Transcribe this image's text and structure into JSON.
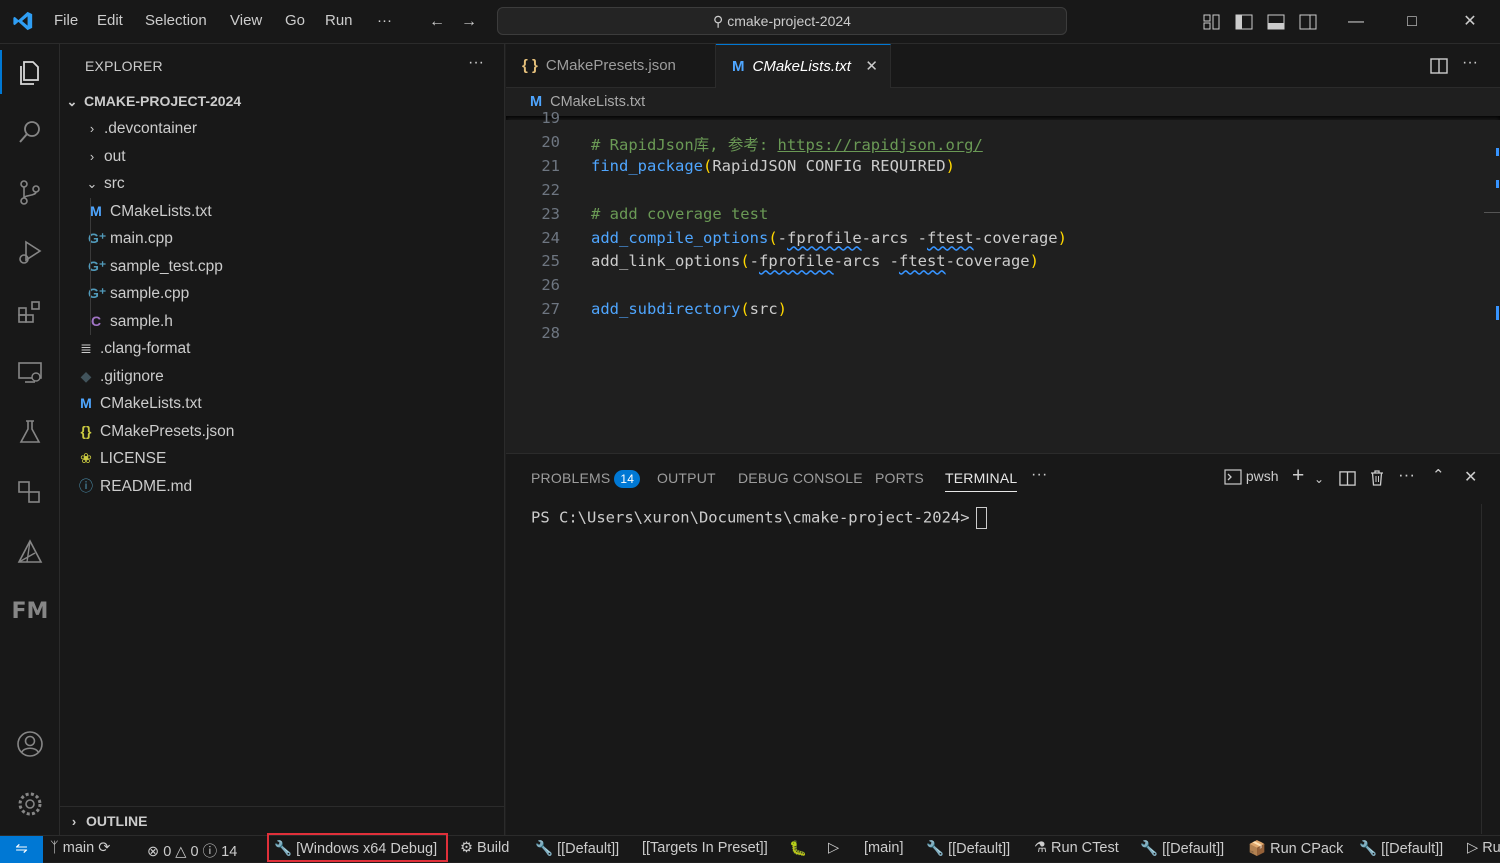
{
  "titlebar": {
    "menu": [
      "File",
      "Edit",
      "Selection",
      "View",
      "Go",
      "Run",
      "···"
    ],
    "command_center": "cmake-project-2024"
  },
  "explorer": {
    "title": "EXPLORER",
    "more": "···",
    "project": "CMAKE-PROJECT-2024",
    "tree": [
      {
        "label": ".devcontainer",
        "type": "folder-collapsed",
        "depth": 1
      },
      {
        "label": "out",
        "type": "folder-collapsed",
        "depth": 1
      },
      {
        "label": "src",
        "type": "folder-expanded",
        "depth": 1
      },
      {
        "label": "CMakeLists.txt",
        "type": "cmake",
        "depth": 2
      },
      {
        "label": "main.cpp",
        "type": "cpp",
        "depth": 2
      },
      {
        "label": "sample_test.cpp",
        "type": "cpp",
        "depth": 2
      },
      {
        "label": "sample.cpp",
        "type": "cpp",
        "depth": 2
      },
      {
        "label": "sample.h",
        "type": "header",
        "depth": 2
      },
      {
        "label": ".clang-format",
        "type": "text",
        "depth": 1
      },
      {
        "label": ".gitignore",
        "type": "git",
        "depth": 1
      },
      {
        "label": "CMakeLists.txt",
        "type": "cmake",
        "depth": 1
      },
      {
        "label": "CMakePresets.json",
        "type": "json",
        "depth": 1
      },
      {
        "label": "LICENSE",
        "type": "license",
        "depth": 1
      },
      {
        "label": "README.md",
        "type": "info",
        "depth": 1
      }
    ],
    "outline": "OUTLINE"
  },
  "editor": {
    "tabs": [
      {
        "label": "CMakePresets.json",
        "icon": "json",
        "active": false
      },
      {
        "label": "CMakeLists.txt",
        "icon": "cmake",
        "active": true
      }
    ],
    "breadcrumb": "CMakeLists.txt",
    "lines": [
      {
        "n": "19",
        "text": ""
      },
      {
        "n": "20",
        "text": "# RapidJson库, 参考: https://rapidjson.org/"
      },
      {
        "n": "21",
        "text": "find_package(RapidJSON CONFIG REQUIRED)"
      },
      {
        "n": "22",
        "text": ""
      },
      {
        "n": "23",
        "text": "# add coverage test"
      },
      {
        "n": "24",
        "text": "add_compile_options(-fprofile-arcs -ftest-coverage)"
      },
      {
        "n": "25",
        "text": "add_link_options(-fprofile-arcs -ftest-coverage)"
      },
      {
        "n": "26",
        "text": ""
      },
      {
        "n": "27",
        "text": "add_subdirectory(src)"
      },
      {
        "n": "28",
        "text": ""
      }
    ]
  },
  "panel": {
    "tabs": [
      "PROBLEMS",
      "OUTPUT",
      "DEBUG CONSOLE",
      "PORTS",
      "TERMINAL"
    ],
    "problems_count": "14",
    "active_tab": "TERMINAL",
    "more": "···",
    "shell": "pwsh",
    "terminal_prompt": "PS C:\\Users\\xuron\\Documents\\cmake-project-2024>"
  },
  "statusbar": {
    "branch": "main",
    "errors": "0",
    "warnings": "0",
    "infos": "14",
    "preset": "[Windows x64 Debug]",
    "build": "Build",
    "build_preset": "[[Default]]",
    "targets": "[[Targets In Preset]]",
    "launch_target": "[main]",
    "test_preset": "[[Default]]",
    "run_ctest": "Run CTest",
    "package_preset": "[[Default]]",
    "run_cpack": "Run CPack",
    "workflow_preset": "[[Default]]",
    "run_workflow": "Ru"
  },
  "colors": {
    "accent": "#0078d4",
    "highlight_box": "#e0303a",
    "function": "#4fa6ff",
    "comment": "#6a9955",
    "paren": "#ffd700"
  }
}
